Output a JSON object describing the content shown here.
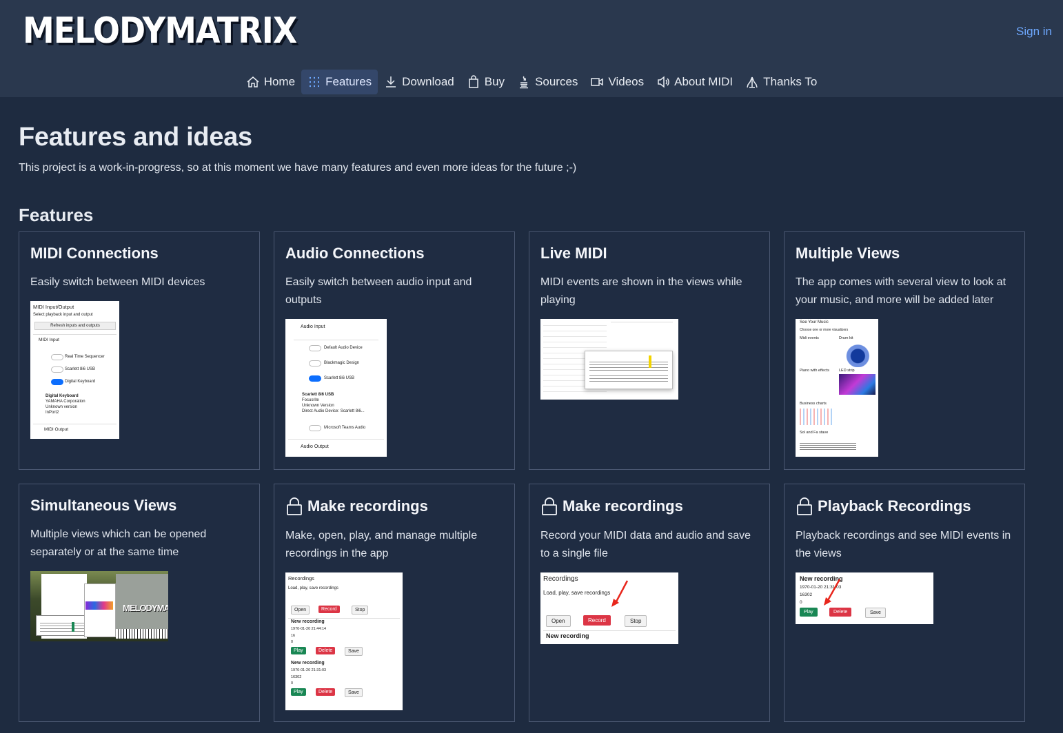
{
  "brand": {
    "logo": "MELODYMATRIX",
    "signin": "Sign in"
  },
  "nav": [
    {
      "label": "Home",
      "icon": "home-icon"
    },
    {
      "label": "Features",
      "icon": "grid-icon",
      "active": true
    },
    {
      "label": "Download",
      "icon": "download-icon"
    },
    {
      "label": "Buy",
      "icon": "bag-icon"
    },
    {
      "label": "Sources",
      "icon": "java-icon"
    },
    {
      "label": "Videos",
      "icon": "camera-icon"
    },
    {
      "label": "About MIDI",
      "icon": "speaker-icon"
    },
    {
      "label": "Thanks To",
      "icon": "hands-icon"
    }
  ],
  "page": {
    "title": "Features and ideas",
    "intro": "This project is a work-in-progress, so at this moment we have many features and even more ideas for the future ;-)",
    "section": "Features"
  },
  "cards": [
    {
      "title": "MIDI Connections",
      "text": "Easily switch between MIDI devices",
      "locked": false
    },
    {
      "title": "Audio Connections",
      "text": "Easily switch between audio input and outputs",
      "locked": false
    },
    {
      "title": "Live MIDI",
      "text": "MIDI events are shown in the views while playing",
      "locked": false
    },
    {
      "title": "Multiple Views",
      "text": "The app comes with several view to look at your music, and more will be added later",
      "locked": false
    },
    {
      "title": "Simultaneous Views",
      "text": "Multiple views which can be opened separately or at the same time",
      "locked": false
    },
    {
      "title": "Make recordings",
      "text": "Make, open, play, and manage multiple recordings in the app",
      "locked": true
    },
    {
      "title": "Make recordings",
      "text": "Record your MIDI data and audio and save to a single file",
      "locked": true
    },
    {
      "title": "Playback Recordings",
      "text": "Playback recordings and see MIDI events in the views",
      "locked": true
    }
  ],
  "thumbs": {
    "midi": {
      "title": "MIDI Input/Output",
      "sub": "Select playback input and output",
      "refresh": "Refresh inputs and outputs",
      "input": "MIDI Input",
      "devices": [
        "Real Time Sequencer",
        "Scarlett 8i6 USB",
        "Digital Keyboard"
      ],
      "detail": [
        "Digital Keyboard",
        "YAMAHA Corporation",
        "Unknown version",
        "InPort2"
      ],
      "output": "MIDI Output"
    },
    "audio": {
      "input": "Audio Input",
      "devices": [
        "Default Audio Device",
        "Blackmagic Design",
        "Scarlett 8i6 USB"
      ],
      "detail": [
        "Scarlett 8i6 USB",
        "Focusrite",
        "Unknown Version",
        "Direct Audio Device: Scarlett 8i6..."
      ],
      "extra": "Microsoft Teams Audio",
      "output": "Audio Output"
    },
    "views": {
      "title": "See Your Music",
      "sub": "Choose one or more visualizers",
      "items": [
        "Midi events",
        "Drum kit",
        "Piano with effects",
        "LED strip",
        "Business charts",
        "Sol and Fa stave"
      ]
    },
    "rec1": {
      "title": "Recordings",
      "sub": "Load, play, save recordings",
      "open": "Open",
      "record": "Record",
      "stop": "Stop",
      "items": [
        {
          "name": "New recording",
          "date": "1970-01-20 21:44:14",
          "a": "16",
          "b": "0"
        },
        {
          "name": "New recording",
          "date": "1970-01-20 21:31:03",
          "a": "16302",
          "b": "0"
        }
      ],
      "play": "Play",
      "delete": "Delete",
      "save": "Save"
    },
    "rec2": {
      "title": "Recordings",
      "sub": "Load, play, save recordings",
      "open": "Open",
      "record": "Record",
      "stop": "Stop",
      "item": "New recording"
    },
    "rec3": {
      "name": "New recording",
      "date": "1970-01-20 21:31:03",
      "a": "16302",
      "b": "0",
      "play": "Play",
      "delete": "Delete",
      "save": "Save"
    },
    "simul_logo": "MELODYMATR"
  }
}
